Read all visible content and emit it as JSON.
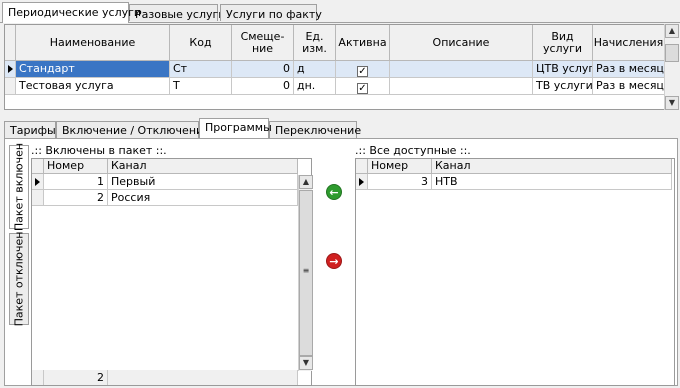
{
  "top_tabs": [
    "Периодические услуги",
    "Разовые услуги",
    "Услуги по факту"
  ],
  "services_grid": {
    "headers": [
      "Наименование",
      "Код",
      "Смеще-\nние",
      "Ед.\nизм.",
      "Активна",
      "Описание",
      "Вид\nуслуги",
      "Начисления"
    ],
    "rows": [
      {
        "name": "Стандарт",
        "code": "Ст",
        "offset": "0",
        "unit": "д",
        "active": "✓",
        "description": "",
        "type": "ЦТВ услуги",
        "charges": "Раз в месяц"
      },
      {
        "name": "Тестовая услуга",
        "code": "Т",
        "offset": "0",
        "unit": "дн.",
        "active": "✓",
        "description": "",
        "type": "ТВ услуги",
        "charges": "Раз в месяц"
      }
    ]
  },
  "mid_tabs": [
    "Тарифы",
    "Включение / Отключение",
    "Программы",
    "Переключение"
  ],
  "side_tabs": [
    "Пакет включен",
    "Пакет отключен"
  ],
  "included": {
    "caption": ".:: Включены в пакет ::.",
    "headers": [
      "Номер",
      "Канал"
    ],
    "rows": [
      {
        "num": "1",
        "channel": "Первый"
      },
      {
        "num": "2",
        "channel": "Россия"
      }
    ],
    "footer_count": "2"
  },
  "available": {
    "caption": ".:: Все доступные ::.",
    "headers": [
      "Номер",
      "Канал"
    ],
    "rows": [
      {
        "num": "3",
        "channel": "НТВ"
      }
    ]
  },
  "colors": {
    "add_button": "#2e9b2e",
    "remove_button": "#d02020",
    "selection": "#3a75c4"
  }
}
